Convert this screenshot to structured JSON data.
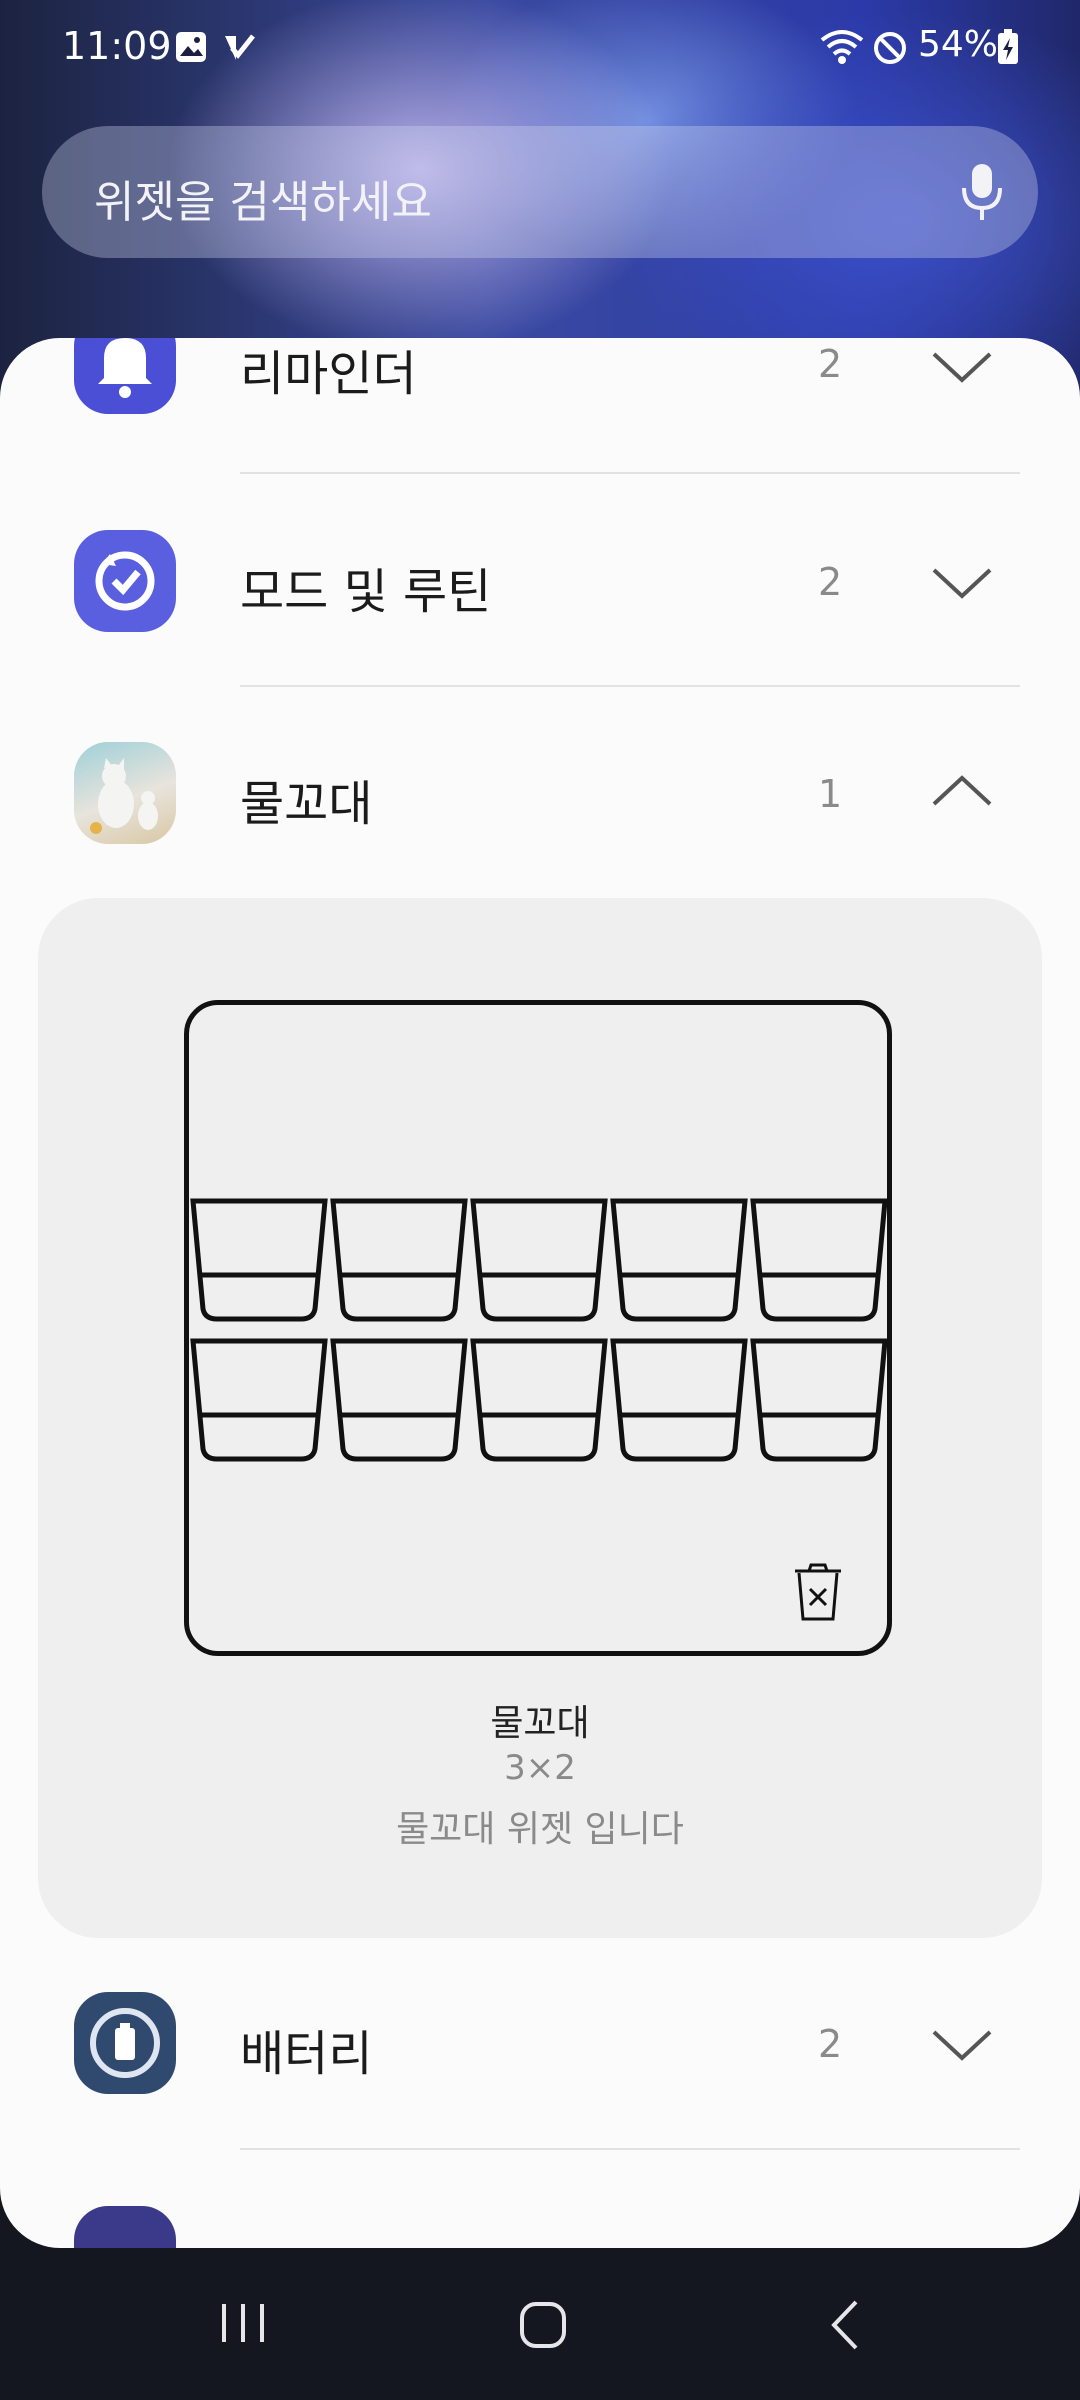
{
  "status_bar": {
    "time": "11:09",
    "battery_percent": "54%",
    "icons": [
      "gallery-icon",
      "check-app-icon",
      "wifi-icon",
      "do-not-disturb-icon",
      "battery-charging-icon"
    ]
  },
  "search": {
    "placeholder": "위젯을 검색하세요",
    "mic_icon": "mic-icon"
  },
  "widget_list": {
    "items": [
      {
        "label": "리마인더",
        "count": "2",
        "expanded": false,
        "icon": "bell-icon",
        "color": "#4b4fd6"
      },
      {
        "label": "모드 및 루틴",
        "count": "2",
        "expanded": false,
        "icon": "routine-check-icon",
        "color": "#5a5fe0"
      },
      {
        "label": "물꼬대",
        "count": "1",
        "expanded": true,
        "icon": "cat-app-icon"
      },
      {
        "label": "배터리",
        "count": "2",
        "expanded": false,
        "icon": "battery-app-icon",
        "color": "#2f4a6e"
      }
    ]
  },
  "preview": {
    "name": "물꼬대",
    "size": "3×2",
    "description": "물꼬대 위젯 입니다",
    "cup_rows": 2,
    "cups_per_row": 5,
    "delete_icon": "trash-x-icon"
  },
  "nav": {
    "recent_icon": "recents-icon",
    "home_icon": "home-icon",
    "back_icon": "back-icon"
  }
}
